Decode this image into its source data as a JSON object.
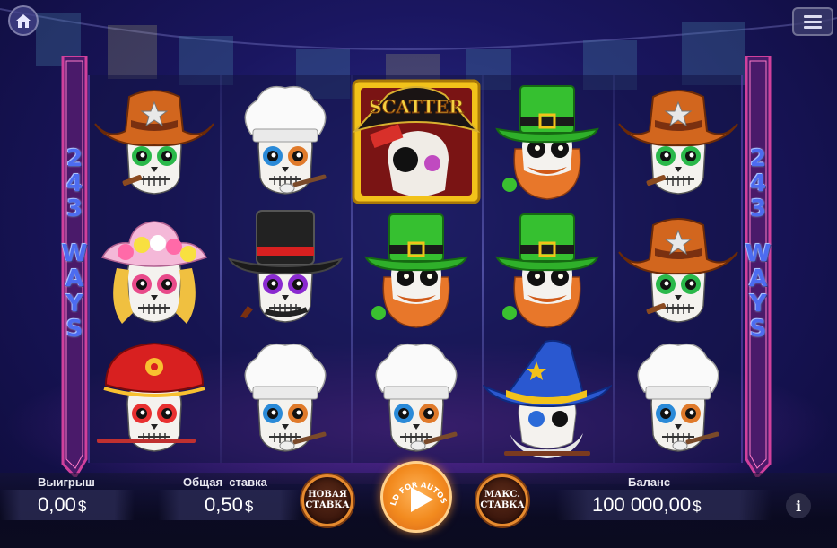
{
  "game": {
    "ways_label_number": "243",
    "ways_label_word": "WAYS"
  },
  "reels": [
    [
      "cowboy-skull",
      "flower-skull",
      "beret-skull"
    ],
    [
      "chef-skull",
      "tophat-skull",
      "chef-skull"
    ],
    [
      "scatter",
      "leprechaun-skull",
      "chef-skull"
    ],
    [
      "leprechaun-skull",
      "leprechaun-skull",
      "wizard-skull"
    ],
    [
      "cowboy-skull",
      "cowboy-skull",
      "chef-skull"
    ]
  ],
  "scatter_text": "SCATTER",
  "bottom": {
    "win_label": "Выигрыш",
    "win_value": "0,00",
    "bet_label": "Общая  ставка",
    "bet_value": "0,50",
    "balance_label": "Баланс",
    "balance_value": "100 000,00",
    "currency": "$",
    "new_bet_line1": "НОВАЯ",
    "new_bet_line2": "СТАВКА",
    "max_bet_line1": "МАКС.",
    "max_bet_line2": "СТАВКА",
    "spin_hint": "HOLD FOR AUTOSPIN",
    "info_label": "i"
  },
  "colors": {
    "accent_orange": "#f28a1e",
    "ways_blue": "#4d6cf0",
    "banner_magenta": "#c0308c"
  }
}
